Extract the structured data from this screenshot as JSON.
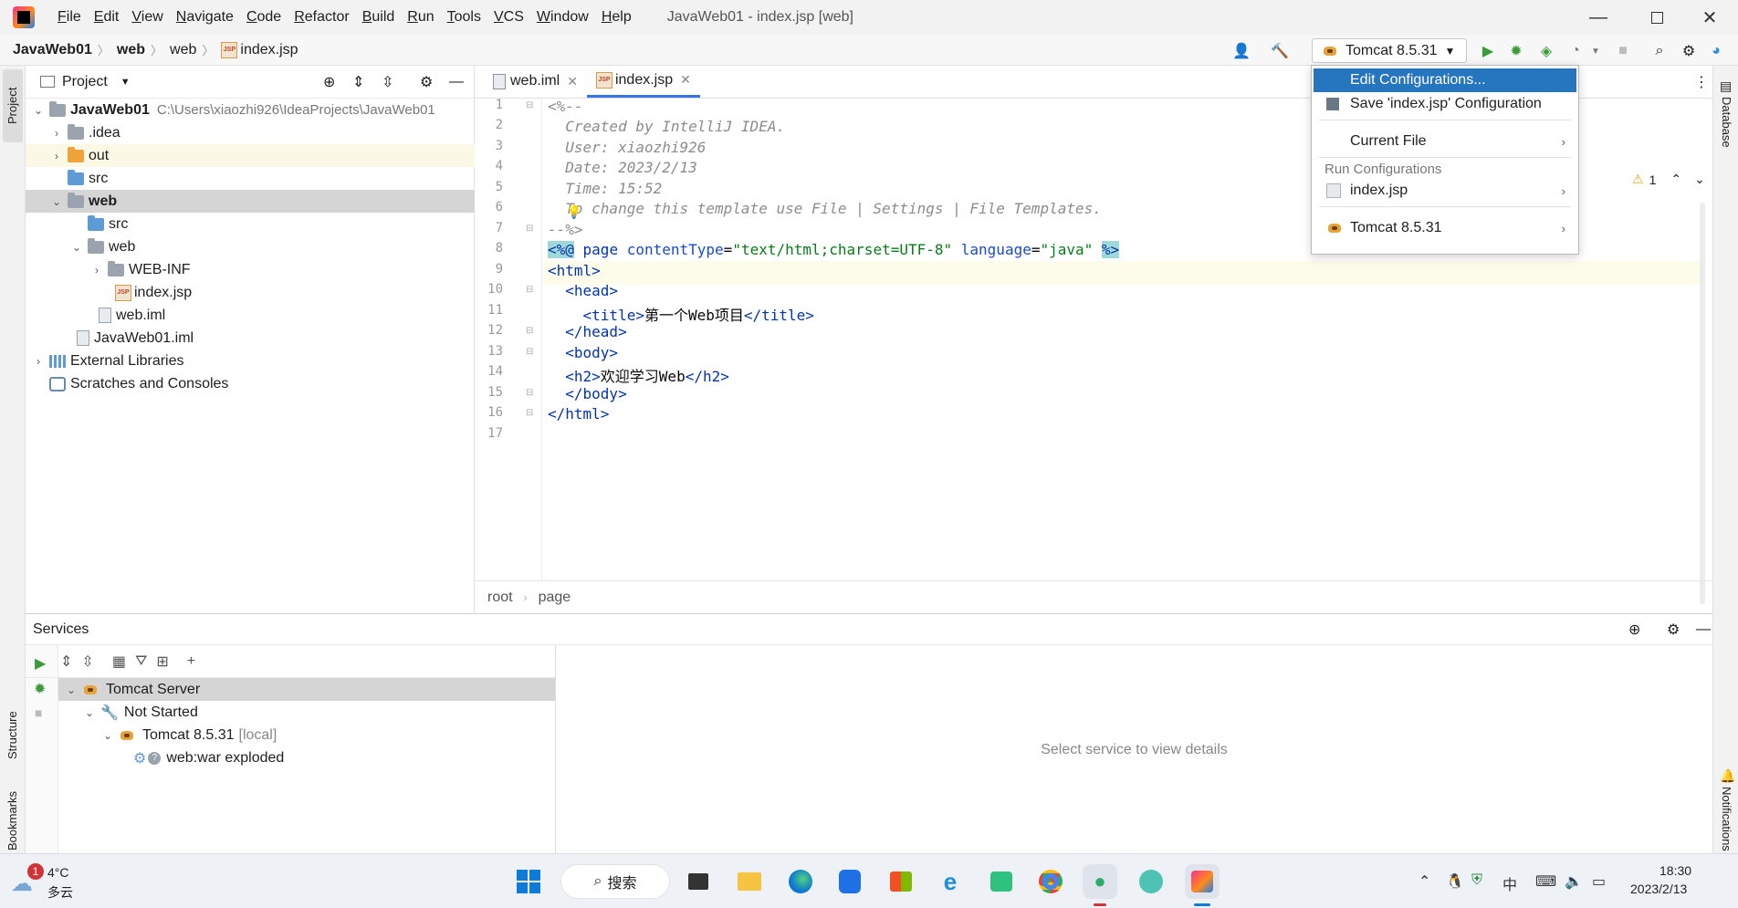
{
  "menu": [
    "File",
    "Edit",
    "View",
    "Navigate",
    "Code",
    "Refactor",
    "Build",
    "Run",
    "Tools",
    "VCS",
    "Window",
    "Help"
  ],
  "window_title": "JavaWeb01 - index.jsp [web]",
  "breadcrumb": [
    "JavaWeb01",
    "web",
    "web",
    "index.jsp"
  ],
  "run_config": "Tomcat 8.5.31",
  "project_panel": {
    "title": "Project",
    "tree": [
      {
        "label": "JavaWeb01",
        "path": "C:\\Users\\xiaozhi926\\IdeaProjects\\JavaWeb01"
      },
      {
        "label": ".idea"
      },
      {
        "label": "out"
      },
      {
        "label": "src"
      },
      {
        "label": "web"
      },
      {
        "label": "src"
      },
      {
        "label": "web"
      },
      {
        "label": "WEB-INF"
      },
      {
        "label": "index.jsp"
      },
      {
        "label": "web.iml"
      },
      {
        "label": "JavaWeb01.iml"
      },
      {
        "label": "External Libraries"
      },
      {
        "label": "Scratches and Consoles"
      }
    ]
  },
  "left_strip": {
    "project": "Project",
    "structure": "Structure",
    "bookmarks": "Bookmarks"
  },
  "right_strip": {
    "database": "Database",
    "notifications": "Notifications"
  },
  "editor": {
    "tabs": [
      "web.iml",
      "index.jsp"
    ],
    "lines": [
      "1",
      "2",
      "3",
      "4",
      "5",
      "6",
      "7",
      "8",
      "9",
      "10",
      "11",
      "12",
      "13",
      "14",
      "15",
      "16",
      "17"
    ],
    "code": {
      "l1": "<%--",
      "l2": "  Created by IntelliJ IDEA.",
      "l3": "  User: xiaozhi926",
      "l4": "  Date: 2023/2/13",
      "l5": "  Time: 15:52",
      "l6": "  To change this template use File | Settings | File Templates.",
      "l7": "--%>",
      "l8_open": "<%@",
      "l8_page": " page ",
      "l8_attr1": "contentType",
      "l8_eq1": "=",
      "l8_val1": "\"text/html;charset=UTF-8\"",
      "l8_attr2": " language",
      "l8_eq2": "=",
      "l8_val2": "\"java\"",
      "l8_close": "%>",
      "l9": "<html>",
      "l10": "  <head>",
      "l11_a": "    <title>",
      "l11_b": "第一个Web项目",
      "l11_c": "</title>",
      "l12": "  </head>",
      "l13": "  <body>",
      "l14_a": "  <h2>",
      "l14_b": "欢迎学习Web",
      "l14_c": "</h2>",
      "l15": "  </body>",
      "l16": "</html>"
    },
    "warning_count": "1",
    "breadcrumb": [
      "root",
      "page"
    ]
  },
  "run_dropdown": {
    "edit": "Edit Configurations...",
    "save": "Save 'index.jsp' Configuration",
    "current_file": "Current File",
    "section": "Run Configurations",
    "index": "index.jsp",
    "tomcat": "Tomcat 8.5.31"
  },
  "services": {
    "title": "Services",
    "tree": [
      {
        "label": "Tomcat Server"
      },
      {
        "label": "Not Started"
      },
      {
        "label": "Tomcat 8.5.31",
        "suffix": "[local]"
      },
      {
        "label": "web:war exploded"
      }
    ],
    "empty": "Select service to view details"
  },
  "taskbar": {
    "weather_temp": "4°C",
    "weather_desc": "多云",
    "weather_badge": "1",
    "search": "搜索",
    "ime": "中",
    "time": "18:30",
    "date": "2023/2/13"
  },
  "colors": {
    "accent": "#3574f0",
    "selection": "#2675bf",
    "tree_selected": "#d5d5d5"
  }
}
